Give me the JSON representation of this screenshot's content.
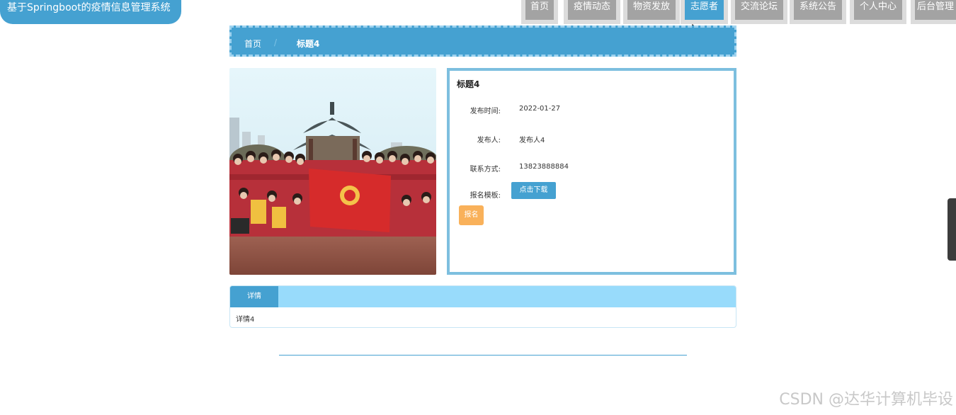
{
  "header": {
    "site_title": "基于Springboot的疫情信息管理系统"
  },
  "nav": {
    "items": [
      {
        "label": "首页",
        "active": false
      },
      {
        "label": "疫情动态",
        "active": false
      },
      {
        "label": "物资发放",
        "active": false
      },
      {
        "label": "志愿者",
        "active": true
      },
      {
        "label": "交流论坛",
        "active": false
      },
      {
        "label": "系统公告",
        "active": false
      },
      {
        "label": "个人中心",
        "active": false
      },
      {
        "label": "后台管理",
        "active": false
      }
    ]
  },
  "breadcrumb": {
    "home": "首页",
    "separator": "/",
    "current": "标题4"
  },
  "detail": {
    "title": "标题4",
    "publish_time_label": "发布时间:",
    "publish_time": "2022-01-27",
    "publisher_label": "发布人:",
    "publisher": "发布人4",
    "contact_label": "联系方式:",
    "contact": "13823888884",
    "template_label": "报名模板:",
    "download_button": "点击下载",
    "signup_button": "报名"
  },
  "details_tab": {
    "tab_label": "详情",
    "content": "详情4"
  },
  "watermark": "CSDN @达华计算机毕设",
  "colors": {
    "primary": "#45a1d1",
    "nav_inactive": "#a3a3a3",
    "signup": "#f9b15a",
    "tabbar": "#98dbfb"
  }
}
